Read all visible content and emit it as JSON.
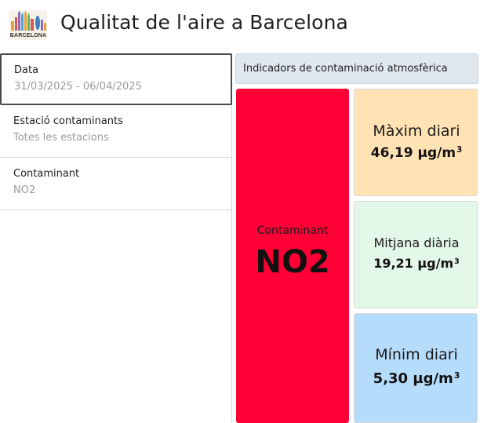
{
  "header": {
    "logo_text": "BARCELONA",
    "title": "Qualitat de l'aire a Barcelona"
  },
  "filters": [
    {
      "label": "Data",
      "value": "31/03/2025 - 06/04/2025"
    },
    {
      "label": "Estació contaminants",
      "value": "Totes les estacions"
    },
    {
      "label": "Contaminant",
      "value": "NO2"
    }
  ],
  "indicators": {
    "section_title": "Indicadors de contaminació atmosfèrica",
    "pollutant_label": "Contaminant",
    "pollutant_value": "NO2",
    "max": {
      "label": "Màxim diari",
      "value": "46,19 µg/m",
      "unit_exp": "3"
    },
    "avg": {
      "label": "Mitjana diària",
      "value": "19,21 µg/m",
      "unit_exp": "3"
    },
    "min": {
      "label": "Mínim diari",
      "value": "5,30 µg/m",
      "unit_exp": "3"
    }
  },
  "colors": {
    "pollutant_card": "#ff0036",
    "max_card": "#ffe3b5",
    "avg_card": "#e3f7e8",
    "min_card": "#b6dcfb",
    "section_title_bg": "#dfe7ef"
  }
}
